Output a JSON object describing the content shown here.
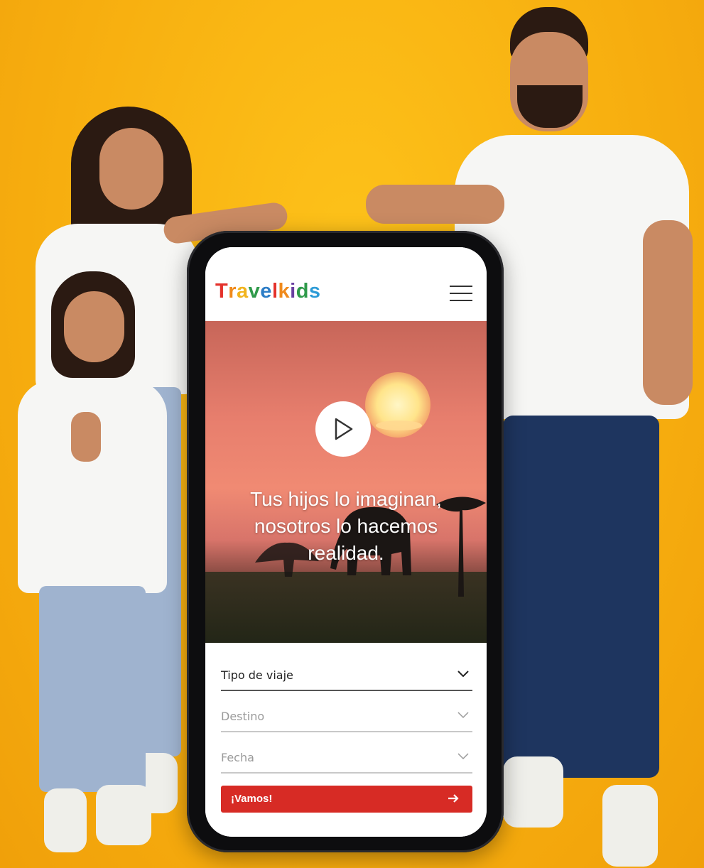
{
  "app": {
    "logo_letters": [
      {
        "ch": "T",
        "color": "#e4312b"
      },
      {
        "ch": "r",
        "color": "#f08a1c"
      },
      {
        "ch": "a",
        "color": "#f2b41d"
      },
      {
        "ch": "v",
        "color": "#2f9a4a"
      },
      {
        "ch": "e",
        "color": "#2d7dc6"
      },
      {
        "ch": "l",
        "color": "#e4312b"
      },
      {
        "ch": "k",
        "color": "#f08a1c"
      },
      {
        "ch": "i",
        "color": "#6a3fa0"
      },
      {
        "ch": "d",
        "color": "#2f9a4a"
      },
      {
        "ch": "s",
        "color": "#2d9bd6"
      }
    ],
    "menu_icon": "hamburger-icon"
  },
  "hero": {
    "play_icon": "play-icon",
    "headline_lines": [
      "Tus hijos lo imaginan,",
      "nosotros lo hacemos",
      "realidad."
    ]
  },
  "form": {
    "trip_type": {
      "label": "Tipo de viaje",
      "active": true
    },
    "destination": {
      "label": "Destino",
      "active": false
    },
    "date": {
      "label": "Fecha",
      "active": false
    },
    "submit_label": "¡Vamos!",
    "submit_icon": "arrow-right-icon"
  },
  "colors": {
    "accent": "#d72b25",
    "background": "#f7ae0f"
  }
}
